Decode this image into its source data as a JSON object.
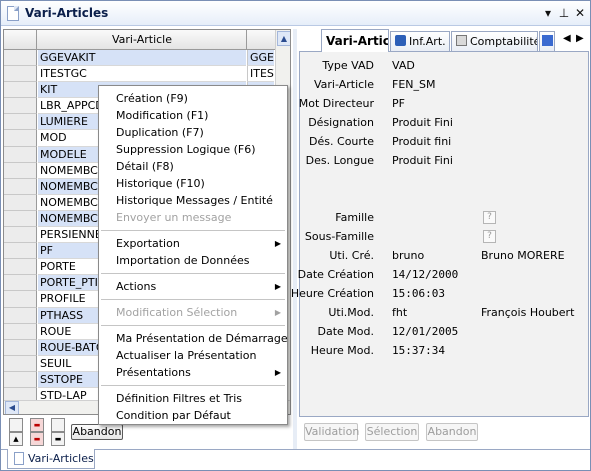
{
  "window": {
    "title": "Vari-Articles"
  },
  "title_buttons": {
    "menu": "▾",
    "pin": "⊥",
    "close": "✕"
  },
  "grid": {
    "column_header": "Vari-Article",
    "rows": [
      {
        "c1": "GGEVAKIT",
        "c2": "GGE V"
      },
      {
        "c1": "ITESTGC",
        "c2": "ITEST"
      },
      {
        "c1": "KIT",
        "c2": ""
      },
      {
        "c1": "LBR_APPCD",
        "c2": ""
      },
      {
        "c1": "LUMIERE",
        "c2": ""
      },
      {
        "c1": "MOD",
        "c2": ""
      },
      {
        "c1": "MODELE",
        "c2": ""
      },
      {
        "c1": "NOMEMBCO",
        "c2": ""
      },
      {
        "c1": "NOMEMBCO",
        "c2": ""
      },
      {
        "c1": "NOMEMBCO",
        "c2": ""
      },
      {
        "c1": "NOMEMBCO",
        "c2": ""
      },
      {
        "c1": "PERSIENNE",
        "c2": ""
      },
      {
        "c1": "PF",
        "c2": ""
      },
      {
        "c1": "PORTE",
        "c2": ""
      },
      {
        "c1": "PORTE_PTI",
        "c2": ""
      },
      {
        "c1": "PROFILE",
        "c2": ""
      },
      {
        "c1": "PTHASS",
        "c2": ""
      },
      {
        "c1": "ROUE",
        "c2": ""
      },
      {
        "c1": "ROUE-BATO",
        "c2": ""
      },
      {
        "c1": "SEUIL",
        "c2": ""
      },
      {
        "c1": "SSTOPE",
        "c2": ""
      },
      {
        "c1": "STD-LAP",
        "c2": ""
      }
    ]
  },
  "left_buttons": {
    "abandon": "Abandon"
  },
  "tabs": [
    {
      "label": "Vari-Article"
    },
    {
      "label": "Inf.Art."
    },
    {
      "label": "Comptabilité"
    }
  ],
  "tab_nav": {
    "prev": "◀",
    "next": "▶"
  },
  "details": {
    "type_vad": {
      "label": "Type VAD",
      "value": "VAD"
    },
    "vari_article": {
      "label": "Vari-Article",
      "value": "FEN_SM"
    },
    "mot_directeur": {
      "label": "Mot Directeur",
      "value": "PF"
    },
    "designation": {
      "label": "Désignation",
      "value": "Produit Fini"
    },
    "des_courte": {
      "label": "Dés. Courte",
      "value": "Produit fini"
    },
    "des_longue": {
      "label": "Des. Longue",
      "value": "Produit Fini"
    },
    "famille": {
      "label": "Famille",
      "value": "?"
    },
    "sous_famille": {
      "label": "Sous-Famille",
      "value": "?"
    },
    "uti_cre": {
      "label": "Uti. Cré.",
      "value": "bruno",
      "extra": "Bruno MORERE"
    },
    "date_creation": {
      "label": "Date Création",
      "value": "14/12/2000"
    },
    "heure_creation": {
      "label": "Heure Création",
      "value": "15:06:03"
    },
    "uti_mod": {
      "label": "Uti.Mod.",
      "value": "fht",
      "extra": "François Houbert"
    },
    "date_mod": {
      "label": "Date Mod.",
      "value": "12/01/2005"
    },
    "heure_mod": {
      "label": "Heure Mod.",
      "value": "15:37:34"
    }
  },
  "right_buttons": {
    "validation": "Validation",
    "selection": "Sélection",
    "abandon": "Abandon"
  },
  "bottom_tab": {
    "label": "Vari-Articles"
  },
  "context_menu": {
    "creation": "Création (F9)",
    "modification": "Modification (F1)",
    "duplication": "Duplication (F7)",
    "suppression": "Suppression Logique (F6)",
    "detail": "Détail (F8)",
    "historique": "Historique (F10)",
    "historique_messages": "Historique Messages / Entité",
    "envoyer_message": "Envoyer un message",
    "exportation": "Exportation",
    "importation": "Importation de Données",
    "actions": "Actions",
    "modification_selection": "Modification Sélection",
    "ma_presentation": "Ma Présentation de Démarrage",
    "actualiser": "Actualiser la Présentation",
    "presentations": "Présentations",
    "definition_filtres": "Définition Filtres et Tris",
    "condition_defaut": "Condition par Défaut",
    "submenu_arrow": "▶"
  }
}
